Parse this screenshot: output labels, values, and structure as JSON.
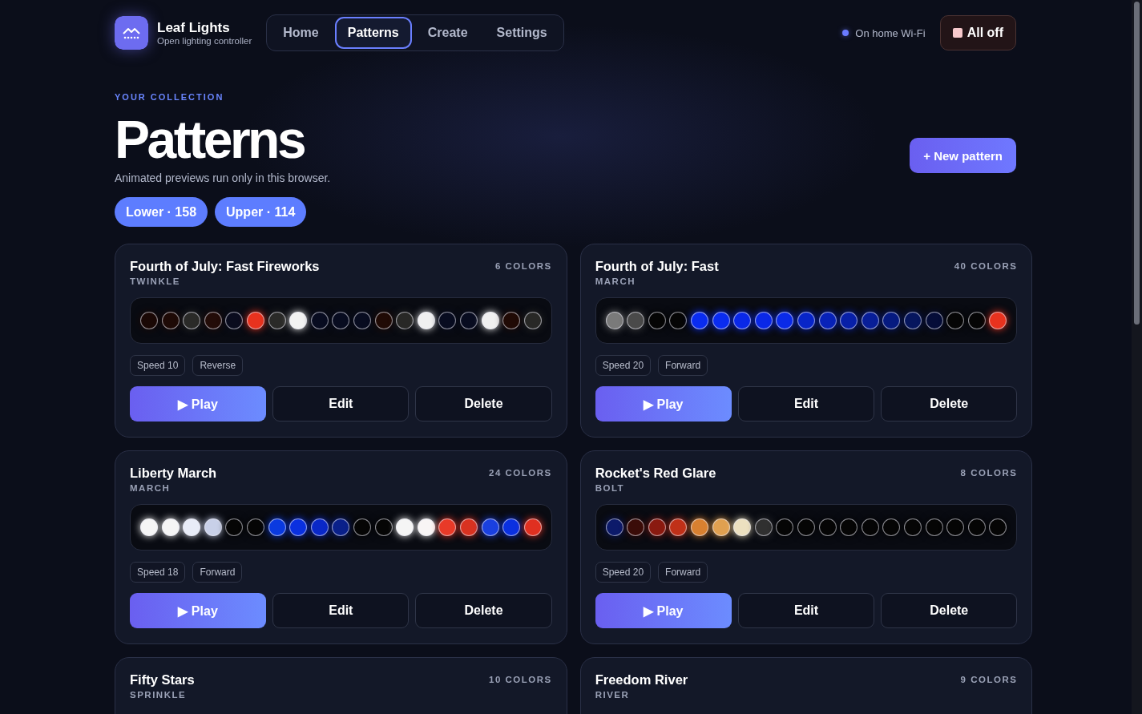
{
  "brand": {
    "name": "Leaf Lights",
    "tagline": "Open lighting controller"
  },
  "nav": [
    {
      "label": "Home",
      "selected": false
    },
    {
      "label": "Patterns",
      "selected": true
    },
    {
      "label": "Create",
      "selected": false
    },
    {
      "label": "Settings",
      "selected": false
    }
  ],
  "connection": {
    "label": "On home Wi-Fi",
    "color": "#6a7bff"
  },
  "all_off_button": "All off",
  "header": {
    "eyebrow": "YOUR COLLECTION",
    "title": "Patterns",
    "subtitle": "Animated previews run only in this browser.",
    "new_button": "+ New pattern"
  },
  "filters": [
    {
      "label": "Lower · 158"
    },
    {
      "label": "Upper · 114"
    }
  ],
  "patterns": [
    {
      "name": "Fourth of July: Fast Fireworks",
      "type": "TWINKLE",
      "count": "6 COLORS",
      "speed": "Speed 10",
      "direction": "Reverse",
      "play": "▶ Play",
      "edit": "Edit",
      "delete": "Delete",
      "leds": [
        {
          "color": "#1a0805"
        },
        {
          "color": "#1e0a06"
        },
        {
          "color": "#2a2a28"
        },
        {
          "color": "#230c08"
        },
        {
          "color": "#0a0c1e"
        },
        {
          "color": "#e8321e"
        },
        {
          "color": "#2a2a28"
        },
        {
          "color": "#f2f2f2"
        },
        {
          "color": "#080c20"
        },
        {
          "color": "#080c20"
        },
        {
          "color": "#080c20"
        },
        {
          "color": "#200a05"
        },
        {
          "color": "#282826"
        },
        {
          "color": "#f0f0f0"
        },
        {
          "color": "#080c20"
        },
        {
          "color": "#080c20"
        },
        {
          "color": "#f0f0f0"
        },
        {
          "color": "#200a05"
        },
        {
          "color": "#282826"
        }
      ]
    },
    {
      "name": "Fourth of July: Fast",
      "type": "MARCH",
      "count": "40 COLORS",
      "speed": "Speed 20",
      "direction": "Forward",
      "play": "▶ Play",
      "edit": "Edit",
      "delete": "Delete",
      "leds": [
        {
          "color": "#7a7a7a"
        },
        {
          "color": "#4a4a4a"
        },
        {
          "color": "#050505"
        },
        {
          "color": "#050505"
        },
        {
          "color": "#0a2cf0"
        },
        {
          "color": "#0a2cf0"
        },
        {
          "color": "#0a28e8"
        },
        {
          "color": "#0a28e8"
        },
        {
          "color": "#0a2ae8"
        },
        {
          "color": "#0825c8"
        },
        {
          "color": "#0822b8"
        },
        {
          "color": "#0820a8"
        },
        {
          "color": "#081e98"
        },
        {
          "color": "#061a80"
        },
        {
          "color": "#06165e"
        },
        {
          "color": "#050d38"
        },
        {
          "color": "#050505"
        },
        {
          "color": "#050505"
        },
        {
          "color": "#e8321e"
        }
      ]
    },
    {
      "name": "Liberty March",
      "type": "MARCH",
      "count": "24 COLORS",
      "speed": "Speed 18",
      "direction": "Forward",
      "play": "▶ Play",
      "edit": "Edit",
      "delete": "Delete",
      "leds": [
        {
          "color": "#f5f5f5"
        },
        {
          "color": "#f5f5f5"
        },
        {
          "color": "#e8ecf8"
        },
        {
          "color": "#c8d0e8"
        },
        {
          "color": "#050505"
        },
        {
          "color": "#050505"
        },
        {
          "color": "#0a3ae0"
        },
        {
          "color": "#0a30e0"
        },
        {
          "color": "#0a28c8"
        },
        {
          "color": "#0a208a"
        },
        {
          "color": "#050505"
        },
        {
          "color": "#050505"
        },
        {
          "color": "#f5f5f5"
        },
        {
          "color": "#f8f5f5"
        },
        {
          "color": "#e83a28"
        },
        {
          "color": "#d83220"
        },
        {
          "color": "#1a40e0"
        },
        {
          "color": "#0a30e0"
        },
        {
          "color": "#e03020"
        }
      ]
    },
    {
      "name": "Rocket's Red Glare",
      "type": "BOLT",
      "count": "8 COLORS",
      "speed": "Speed 20",
      "direction": "Forward",
      "play": "▶ Play",
      "edit": "Edit",
      "delete": "Delete",
      "leds": [
        {
          "color": "#0c1a6a"
        },
        {
          "color": "#3a0c08"
        },
        {
          "color": "#8a1a10"
        },
        {
          "color": "#c03018"
        },
        {
          "color": "#d88030"
        },
        {
          "color": "#e0a050"
        },
        {
          "color": "#ece0c0"
        },
        {
          "color": "#303030"
        },
        {
          "color": "#050505"
        },
        {
          "color": "#050505"
        },
        {
          "color": "#050505"
        },
        {
          "color": "#050505"
        },
        {
          "color": "#050505"
        },
        {
          "color": "#050505"
        },
        {
          "color": "#050505"
        },
        {
          "color": "#050505"
        },
        {
          "color": "#050505"
        },
        {
          "color": "#050505"
        },
        {
          "color": "#050505"
        }
      ]
    },
    {
      "name": "Fifty Stars",
      "type": "SPRINKLE",
      "count": "10 COLORS"
    },
    {
      "name": "Freedom River",
      "type": "RIVER",
      "count": "9 COLORS"
    }
  ]
}
